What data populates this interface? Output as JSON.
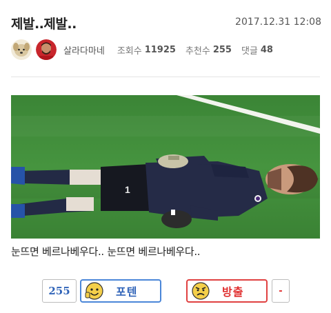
{
  "post": {
    "title": "제발..제발..",
    "date": "2017.12.31 12:08"
  },
  "meta": {
    "author": "살라다마네",
    "views_label": "조회수",
    "views_value": "11925",
    "recommend_label": "추천수",
    "recommend_value": "255",
    "comments_label": "댓글",
    "comments_value": "48"
  },
  "image": {
    "jersey_number": "1",
    "colors": {
      "grass": "#3f8a3a",
      "kit": "#252b47"
    }
  },
  "caption": "눈뜨면 베르나베우다.. 눈뜨면 베르나베우다..",
  "votes": {
    "count": "255",
    "up_label": "포텐",
    "down_label": "방출",
    "minus_label": "-",
    "colors": {
      "up": "#4a86d8",
      "down": "#e04040"
    }
  }
}
